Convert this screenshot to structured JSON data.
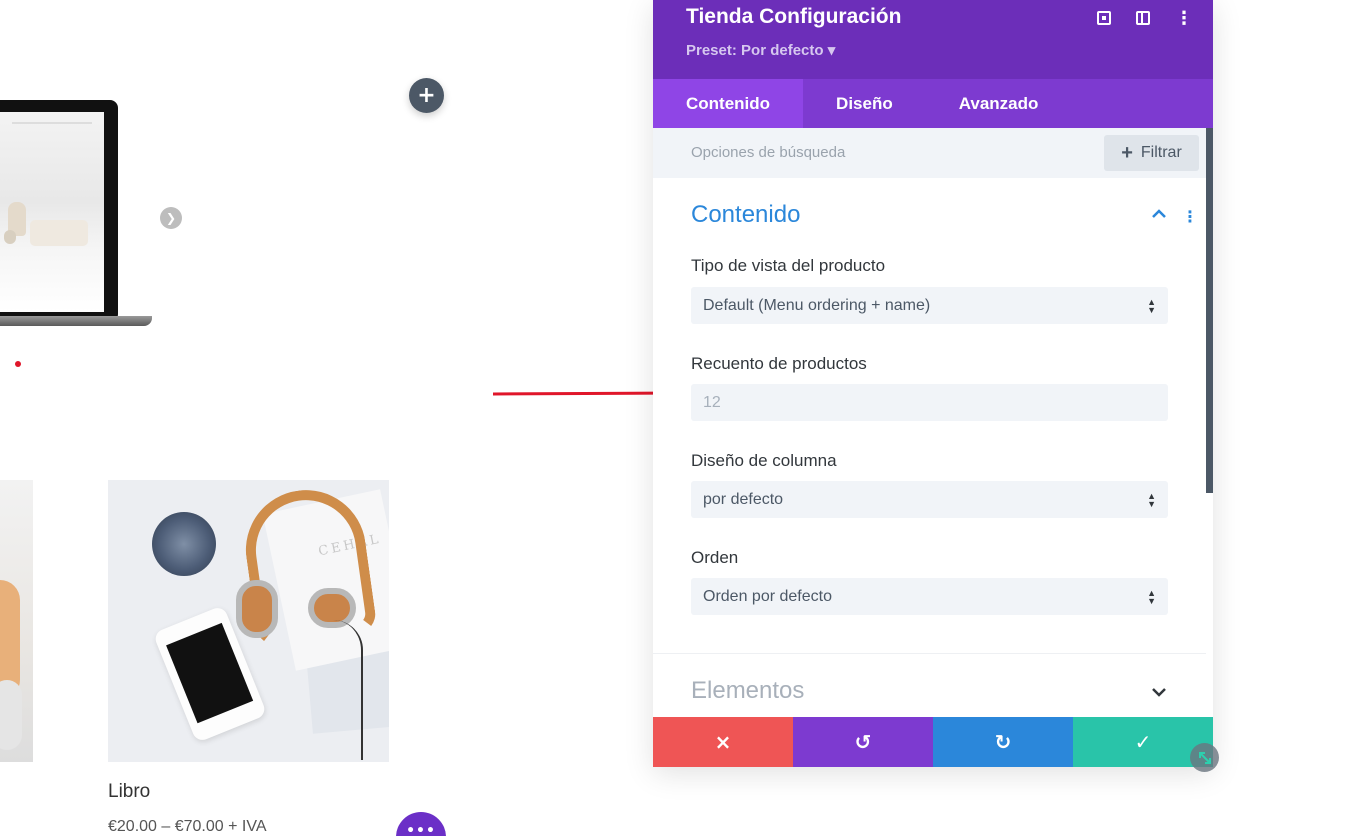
{
  "panel": {
    "title": "Tienda Configuración",
    "preset": "Preset: Por defecto ▾",
    "header_icons": [
      "focus-icon",
      "split-view-icon",
      "more-vertical-icon"
    ],
    "tabs": [
      {
        "label": "Contenido",
        "active": true
      },
      {
        "label": "Diseño",
        "active": false
      },
      {
        "label": "Avanzado",
        "active": false
      }
    ],
    "search_placeholder": "Opciones de búsqueda",
    "filter_label": "Filtrar",
    "section": {
      "title": "Contenido",
      "fields": {
        "view_type": {
          "label": "Tipo de vista del producto",
          "value": "Default (Menu ordering + name)"
        },
        "product_count": {
          "label": "Recuento de productos",
          "placeholder": "12"
        },
        "column_layout": {
          "label": "Diseño de columna",
          "value": "por defecto"
        },
        "order": {
          "label": "Orden",
          "value": "Orden por defecto"
        }
      }
    },
    "section2_title": "Elementos",
    "footer": {
      "cancel_icon": "×",
      "undo_icon": "↺",
      "redo_icon": "↻",
      "save_icon": "✓"
    }
  },
  "canvas": {
    "product_title": "Libro",
    "product_price": "€20.00 – €70.00 + IVA",
    "add_icon": "+",
    "purple_button_text": "•••"
  },
  "colors": {
    "header": "#6c2eb9",
    "tabs": "#7d3ad0",
    "active_tab": "#8f45e6",
    "accent_blue": "#2b87da",
    "cancel": "#ef5555",
    "save": "#29c4a9",
    "annotation_arrow": "#e0162a"
  }
}
